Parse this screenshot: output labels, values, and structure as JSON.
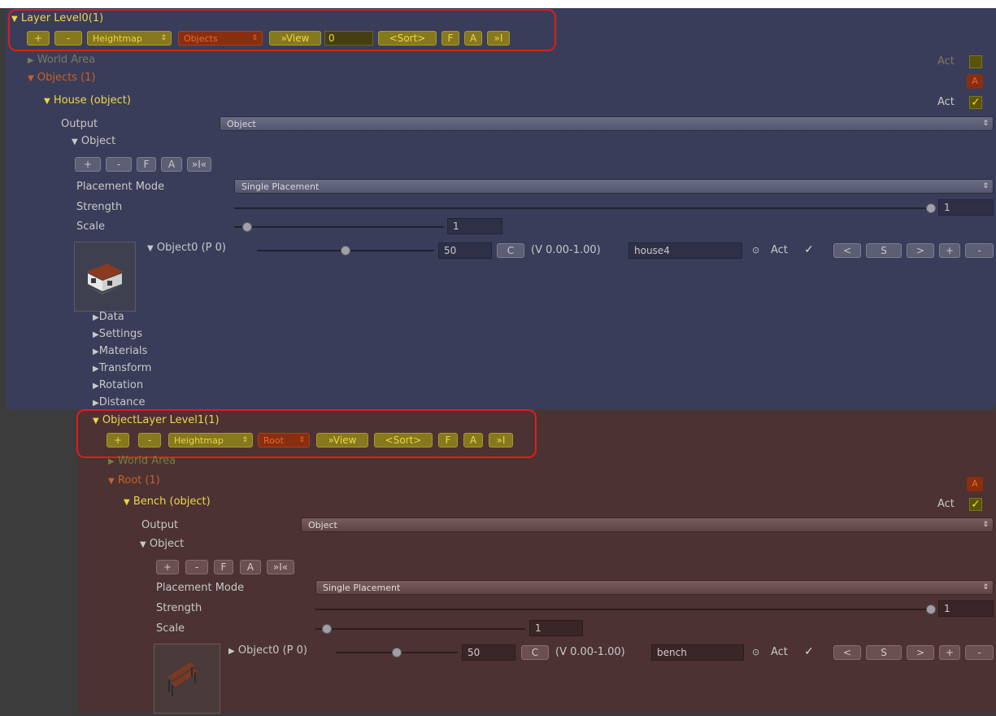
{
  "layer0": {
    "title": "Layer Level0(1)",
    "buttons": {
      "add": "+",
      "remove": "-",
      "heightmap": "Heightmap",
      "objects": "Objects",
      "view": "»View",
      "field": "0",
      "sort": "<Sort>",
      "f": "F",
      "a": "A",
      "end": "»I"
    },
    "world_area": "World Area",
    "act_label": "Act",
    "objects_header": "Objects (1)",
    "a_badge": "A",
    "house_header": "House (object)",
    "house_act": "Act",
    "output_label": "Output",
    "output_value": "Object",
    "object_header": "Object",
    "obj_buttons": {
      "add": "+",
      "remove": "-",
      "f": "F",
      "a": "A",
      "end": "»I«"
    },
    "placement_label": "Placement Mode",
    "placement_value": "Single Placement",
    "strength_label": "Strength",
    "strength_value": "1",
    "scale_label": "Scale",
    "scale_value": "1",
    "object0_label": "Object0 (P 0)",
    "object0_value": "50",
    "c_button": "C",
    "range_label": "(V 0.00-1.00)",
    "object_name": "house4",
    "act_item_label": "Act",
    "nav": {
      "prev": "<",
      "s": "S",
      "next": ">",
      "add": "+",
      "remove": "-"
    },
    "sections": [
      "Data",
      "Settings",
      "Materials",
      "Transform",
      "Rotation",
      "Distance"
    ]
  },
  "layer1": {
    "title": "ObjectLayer Level1(1)",
    "buttons": {
      "add": "+",
      "remove": "-",
      "heightmap": "Heightmap",
      "root": "Root",
      "view": "»View",
      "sort": "<Sort>",
      "f": "F",
      "a": "A",
      "end": "»I"
    },
    "world_area": "World Area",
    "root_header": "Root (1)",
    "a_badge": "A",
    "bench_header": "Bench (object)",
    "bench_act": "Act",
    "output_label": "Output",
    "output_value": "Object",
    "object_header": "Object",
    "obj_buttons": {
      "add": "+",
      "remove": "-",
      "f": "F",
      "a": "A",
      "end": "»I«"
    },
    "placement_label": "Placement Mode",
    "placement_value": "Single Placement",
    "strength_label": "Strength",
    "strength_value": "1",
    "scale_label": "Scale",
    "scale_value": "1",
    "object0_label": "Object0 (P 0)",
    "object0_value": "50",
    "c_button": "C",
    "range_label": "(V 0.00-1.00)",
    "object_name": "bench",
    "act_item_label": "Act",
    "nav": {
      "prev": "<",
      "s": "S",
      "next": ">",
      "add": "+",
      "remove": "-"
    }
  },
  "colors": {
    "panel_blue": "#3a3d59",
    "panel_red": "#4c3232",
    "accent_yellow": "#ecd64a",
    "accent_orange": "#e86a2a",
    "highlight_red": "#e01c1c"
  },
  "icons": [
    "triangle-down-icon",
    "triangle-right-icon",
    "checkmark-icon",
    "radio-icon",
    "house-thumbnail",
    "bench-thumbnail",
    "updown-arrows-icon"
  ]
}
